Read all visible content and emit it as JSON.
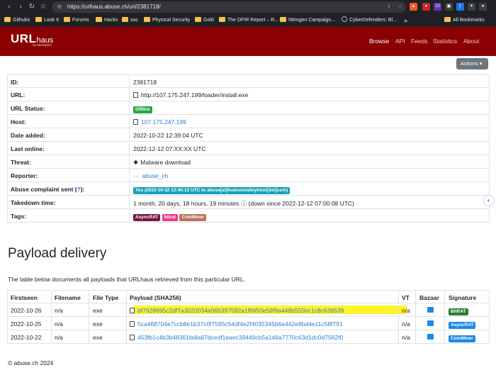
{
  "browser": {
    "url": "https://urlhaus.abuse.ch/url/2381718/",
    "bookmarks": [
      "Githubs",
      "Look It",
      "Forums",
      "Hacks",
      "soc",
      "Physical Security",
      "Gold",
      "The DFIR Report – R...",
      "Nitrogen Campaign...",
      "CyberDefenders: Bl...",
      "All Bookmarks"
    ],
    "more_label": "»"
  },
  "header": {
    "logo_main": "URL",
    "logo_sub": "haus",
    "logo_by": "by ABUSE|ch",
    "nav": [
      "Browse",
      "API",
      "Feeds",
      "Statistics",
      "About"
    ]
  },
  "actions_label": "Actions",
  "info": {
    "rows": [
      {
        "key": "ID:",
        "value": "2381718"
      },
      {
        "key": "URL:",
        "value": "http://107.175.247.199/loader/install.exe"
      },
      {
        "key": "URL Status:",
        "badge": "Offline"
      },
      {
        "key": "Host:",
        "value": "107.175.247.199"
      },
      {
        "key": "Date added:",
        "value": "2022-10-22 12:39:04 UTC"
      },
      {
        "key": "Last online:",
        "value": "2022-12-12 07:XX:XX UTC"
      },
      {
        "key": "Threat:",
        "value": "Malware download"
      },
      {
        "key": "Reporter:",
        "value": "abuse_ch"
      },
      {
        "key": "Abuse complaint sent (?):",
        "badge": "Yes (2022-10-22 12:40:12 UTC to abuse[at]hudsonvalleyhost[dot]com)"
      },
      {
        "key": "Takedown time:",
        "value": "1 month, 20 days, 18 hours, 19 minutes",
        "value2": "(down since 2022-12-12 07:00:08 UTC)"
      },
      {
        "key": "Tags:",
        "tags": [
          "AsyncRAT",
          "bitrat",
          "CoinMiner"
        ]
      }
    ],
    "complaint_key_pre": "Abuse complaint sent (",
    "complaint_key_link": "?",
    "complaint_key_post": "):"
  },
  "payload": {
    "title": "Payload delivery",
    "description": "The table below documents all payloads that URLhaus retrieved from this particular URL.",
    "columns": [
      "Firstseen",
      "Filename",
      "File Type",
      "Payload (SHA256)",
      "VT",
      "Bazaar",
      "Signature"
    ],
    "rows": [
      {
        "firstseen": "2022-10-26",
        "filename": "n/a",
        "filetype": "exe",
        "sha256": "bf7628695c2df7a3020034a065397592a1f8850e59f9a448b555bc1c8c639539",
        "vt": "n/a",
        "signature": "BitRAT"
      },
      {
        "firstseen": "2022-10-25",
        "filename": "n/a",
        "filetype": "exe",
        "sha256": "5ca468704e7ccb8e1b37c0f7595c54df4e2f4035345b6e442e8bd4e11c58f791",
        "vt": "n/a",
        "signature": "AsyncRAT"
      },
      {
        "firstseen": "2022-10-22",
        "filename": "n/a",
        "filetype": "exe",
        "sha256": "453fb1c4b3b48361fa8a67dcedf1eaec39449cb5a146a7770c63d1dc0d7562f0",
        "vt": "n/a",
        "signature": "CoinMiner"
      }
    ]
  },
  "footer": "© abuse.ch 2024",
  "colors": {
    "header_bg": "#8b0000",
    "link": "#2a7bd6",
    "highlight": "#fff200"
  }
}
